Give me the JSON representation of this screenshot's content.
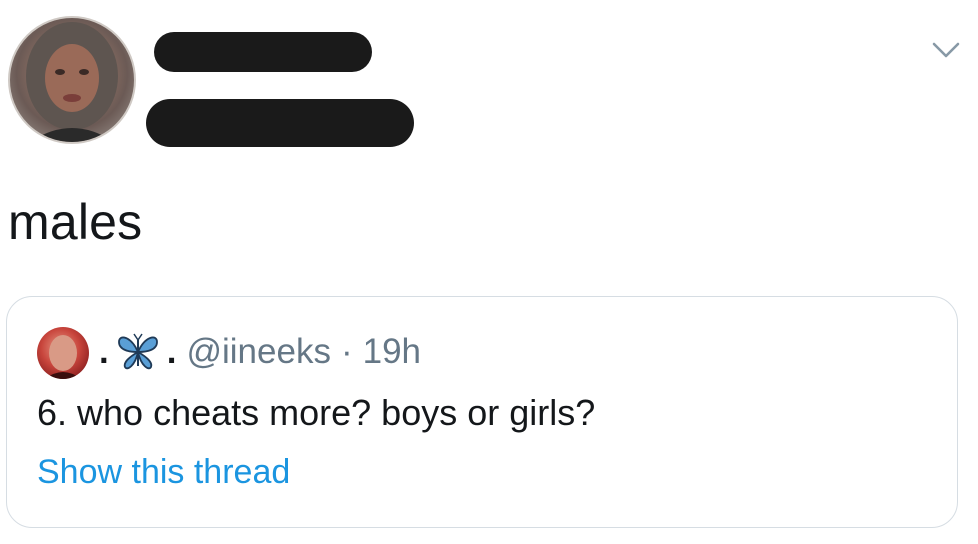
{
  "tweet": {
    "text": "males",
    "avatar_icon": "profile-photo",
    "caret_icon": "chevron-down-icon"
  },
  "quoted_tweet": {
    "name_prefix": ".",
    "name_emoji": "butterfly-icon",
    "name_suffix": ".",
    "handle": "@iineeks",
    "separator": "·",
    "time": "19h",
    "text": "6. who cheats more? boys or girls?",
    "show_thread": "Show this thread"
  },
  "colors": {
    "text_primary": "#14171a",
    "text_secondary": "#657786",
    "link": "#1b95e0",
    "border": "#d6dde3",
    "butterfly": "#5a9fd6",
    "redaction": "#1a1a1a"
  }
}
